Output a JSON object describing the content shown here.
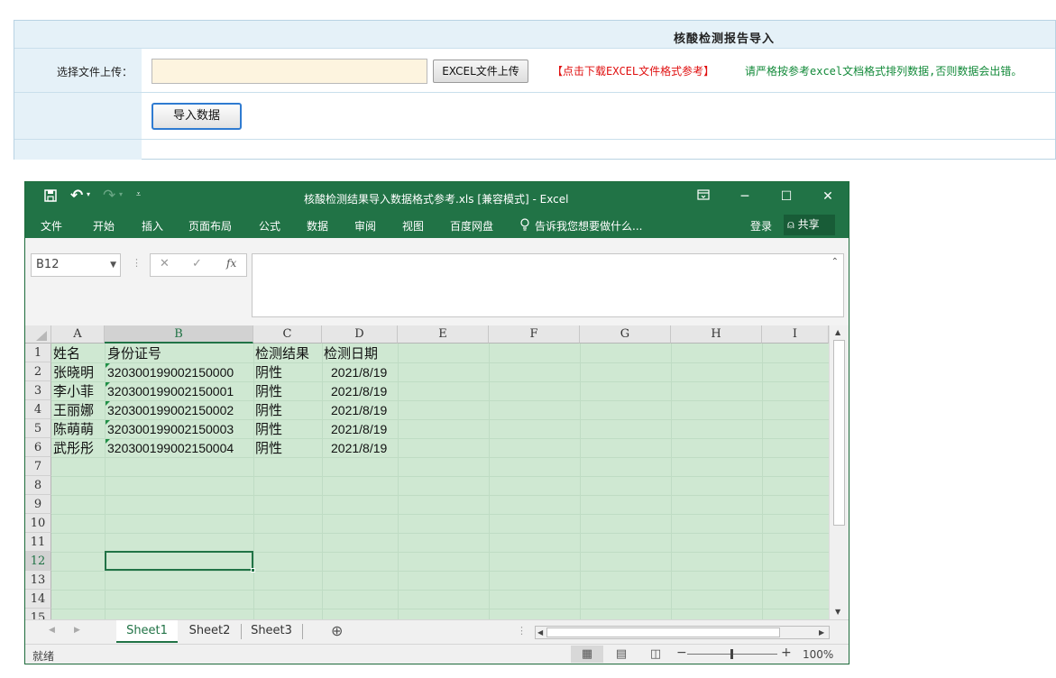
{
  "form": {
    "title": "核酸检测报告导入",
    "upload_label": "选择文件上传：",
    "file_value": "",
    "upload_button": "EXCEL文件上传",
    "download_link": "【点击下载EXCEL文件格式参考】",
    "note": "请严格按参考excel文档格式排列数据,否则数据会出错。",
    "import_button": "导入数据"
  },
  "excel": {
    "title": "核酸检测结果导入数据格式参考.xls  [兼容模式] - Excel",
    "quick_access": [
      "save-icon",
      "undo-icon",
      "redo-icon",
      "customize-icon"
    ],
    "menu": [
      "文件",
      "开始",
      "插入",
      "页面布局",
      "公式",
      "数据",
      "审阅",
      "视图",
      "百度网盘"
    ],
    "tell_me": "告诉我您想要做什么...",
    "login": "登录",
    "share": "共享",
    "name_box": "B12",
    "formula": "",
    "columns": [
      "A",
      "B",
      "C",
      "D",
      "E",
      "F",
      "G",
      "H",
      "I"
    ],
    "selected_column": "B",
    "rows": [
      "1",
      "2",
      "3",
      "4",
      "5",
      "6",
      "7",
      "8",
      "9",
      "10",
      "11",
      "12",
      "13",
      "14",
      "15"
    ],
    "selected_row": "12",
    "header_row": [
      "姓名",
      "身份证号",
      "检测结果",
      "检测日期"
    ],
    "data_rows": [
      [
        "张晓明",
        "320300199002150000",
        "阴性",
        "2021/8/19"
      ],
      [
        "李小菲",
        "320300199002150001",
        "阴性",
        "2021/8/19"
      ],
      [
        "王丽娜",
        "320300199002150002",
        "阴性",
        "2021/8/19"
      ],
      [
        "陈萌萌",
        "320300199002150003",
        "阴性",
        "2021/8/19"
      ],
      [
        "武彤彤",
        "320300199002150004",
        "阴性",
        "2021/8/19"
      ]
    ],
    "sheets": [
      "Sheet1",
      "Sheet2",
      "Sheet3"
    ],
    "active_sheet": "Sheet1",
    "status": "就绪",
    "zoom": "100%",
    "accent_color": "#217346"
  }
}
